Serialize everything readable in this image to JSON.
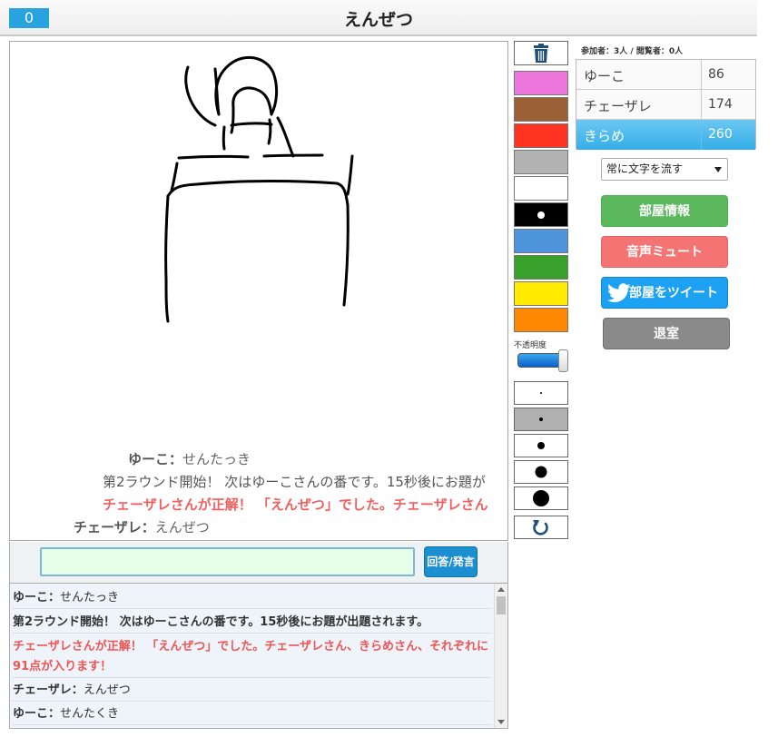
{
  "header": {
    "score": "0",
    "title": "えんぜつ"
  },
  "stream": [
    {
      "name": "ゆーこ：",
      "text": "せんたっき",
      "kind": "user"
    },
    {
      "name": "",
      "text": "第2ラウンド開始！ 次はゆーこさんの番です。15秒後にお題が",
      "kind": "system"
    },
    {
      "name": "",
      "text": "チェーザレさんが正解！ 「えんぜつ」でした。チェーザレさん",
      "kind": "correct"
    },
    {
      "name": "チェーザレ：",
      "text": "えんぜつ",
      "kind": "user"
    }
  ],
  "answer": {
    "value": "",
    "button_label": "回答/発言"
  },
  "log": [
    {
      "name": "ゆーこ：",
      "text": "せんたっき",
      "kind": "user"
    },
    {
      "name": "",
      "text": "第2ラウンド開始！ 次はゆーこさんの番です。15秒後にお題が出題されます。",
      "kind": "system"
    },
    {
      "name": "",
      "text": "チェーザレさんが正解！ 「えんぜつ」でした。チェーザレさん、きらめさん、それぞれに91点が入ります！",
      "kind": "correct"
    },
    {
      "name": "チェーザレ：",
      "text": "えんぜつ",
      "kind": "user"
    },
    {
      "name": "ゆーこ：",
      "text": "せんたくき",
      "kind": "user"
    }
  ],
  "tools": {
    "trash_icon": "trash-icon",
    "colors": [
      "#ee77dd",
      "#9b6035",
      "#ff3322",
      "#b3b3b3",
      "#ffffff",
      "#000000",
      "#4d94dd",
      "#3aa02c",
      "#ffea00",
      "#ff8800"
    ],
    "selected_color": "#000000",
    "opacity_label": "不透明度",
    "opacity": 0.95,
    "brush_sizes": [
      1,
      2,
      5,
      8,
      11
    ],
    "selected_size": 2,
    "undo_icon": "undo-icon"
  },
  "room": {
    "participants_label": "参加者：3人 / 閲覧者：0人"
  },
  "ranking": [
    {
      "name": "ゆーこ",
      "score": "86",
      "active": false
    },
    {
      "name": "チェーザレ",
      "score": "174",
      "active": false
    },
    {
      "name": "きらめ",
      "score": "260",
      "active": true
    }
  ],
  "controls": {
    "flow_mode": "常に文字を流す",
    "room_info": "部屋情報",
    "mute": "音声ミュート",
    "tweet": "部屋をツイート",
    "leave": "退室"
  }
}
